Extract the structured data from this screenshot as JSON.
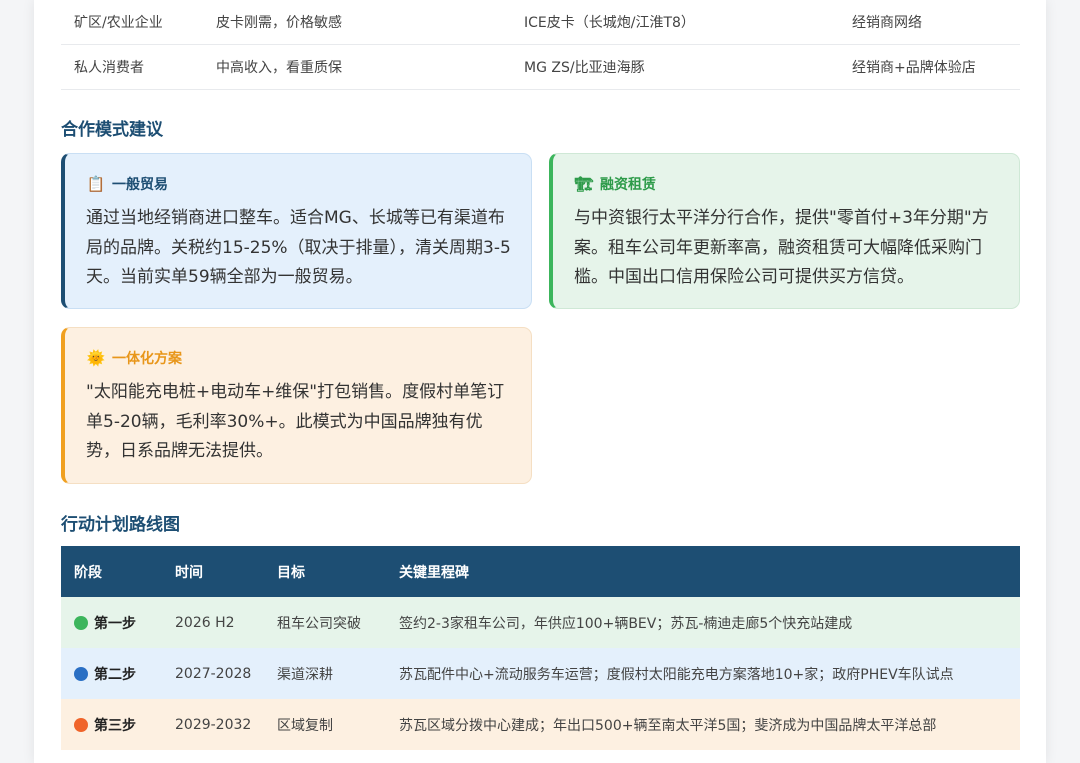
{
  "customers": [
    {
      "segment": "矿区/农业企业",
      "need": "皮卡刚需，价格敏感",
      "competitor": "ICE皮卡（长城炮/江淮T8）",
      "channel": "经销商网络"
    },
    {
      "segment": "私人消费者",
      "need": "中高收入，看重质保",
      "competitor": "MG ZS/比亚迪海豚",
      "channel": "经销商+品牌体验店"
    }
  ],
  "coop": {
    "heading": "合作模式建议",
    "cards": [
      {
        "icon": "clipboard-icon",
        "glyph": "📋",
        "title": "一般贸易",
        "body": "通过当地经销商进口整车。适合MG、长城等已有渠道布局的品牌。关税约15-25%（取决于排量），清关周期3-5天。当前实单59辆全部为一般贸易。"
      },
      {
        "icon": "crane-icon",
        "glyph": "🏗",
        "title": "融资租赁",
        "body": "与中资银行太平洋分行合作，提供\"零首付+3年分期\"方案。租车公司年更新率高，融资租赁可大幅降低采购门槛。中国出口信用保险公司可提供买方信贷。"
      },
      {
        "icon": "sun-icon",
        "glyph": "🌞",
        "title": "一体化方案",
        "body": "\"太阳能充电桩+电动车+维保\"打包销售。度假村单笔订单5-20辆，毛利率30%+。此模式为中国品牌独有优势，日系品牌无法提供。"
      }
    ]
  },
  "roadmap": {
    "heading": "行动计划路线图",
    "headers": [
      "阶段",
      "时间",
      "目标",
      "关键里程碑"
    ],
    "rows": [
      {
        "stage": "第一步",
        "color": "#3cb55c",
        "time": "2026 H2",
        "goal": "租车公司突破",
        "milestone": "签约2-3家租车公司，年供应100+辆BEV；苏瓦-楠迪走廊5个快充站建成"
      },
      {
        "stage": "第二步",
        "color": "#2a6fc4",
        "time": "2027-2028",
        "goal": "渠道深耕",
        "milestone": "苏瓦配件中心+流动服务车运营；度假村太阳能充电方案落地10+家；政府PHEV车队试点"
      },
      {
        "stage": "第三步",
        "color": "#f0642a",
        "time": "2029-2032",
        "goal": "区域复制",
        "milestone": "苏瓦区域分拨中心建成；年出口500+辆至南太平洋5国；斐济成为中国品牌太平洋总部"
      }
    ]
  }
}
